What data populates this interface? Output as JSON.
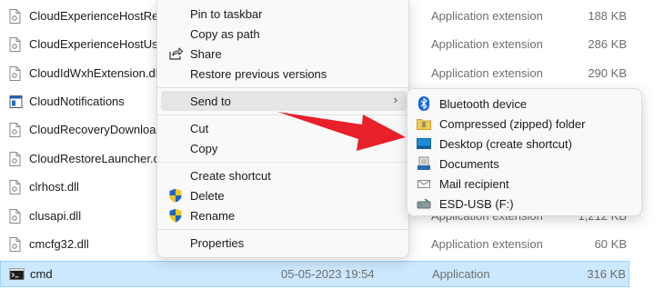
{
  "files": [
    {
      "name": "CloudExperienceHostRedir",
      "date": "",
      "type": "Application extension",
      "size": "188 KB",
      "icon": "dll-file-icon"
    },
    {
      "name": "CloudExperienceHostUser.",
      "date": "",
      "type": "Application extension",
      "size": "286 KB",
      "icon": "dll-file-icon"
    },
    {
      "name": "CloudIdWxhExtension.dll",
      "date": "",
      "type": "Application extension",
      "size": "290 KB",
      "icon": "dll-file-icon"
    },
    {
      "name": "CloudNotifications",
      "date": "",
      "type": "",
      "size": "",
      "icon": "app-window-icon"
    },
    {
      "name": "CloudRecoveryDownloadT",
      "date": "",
      "type": "",
      "size": "",
      "icon": "dll-file-icon"
    },
    {
      "name": "CloudRestoreLauncher.dll",
      "date": "",
      "type": "",
      "size": "",
      "icon": "dll-file-icon"
    },
    {
      "name": "clrhost.dll",
      "date": "",
      "type": "",
      "size": "",
      "icon": "dll-file-icon"
    },
    {
      "name": "clusapi.dll",
      "date": "",
      "type": "Application extension",
      "size": "1,212 KB",
      "icon": "dll-file-icon"
    },
    {
      "name": "cmcfg32.dll",
      "date": "",
      "type": "Application extension",
      "size": "60 KB",
      "icon": "dll-file-icon"
    },
    {
      "name": "cmd",
      "date": "05-05-2023 19:54",
      "type": "Application",
      "size": "316 KB",
      "icon": "cmd-terminal-icon"
    }
  ],
  "context_menu": {
    "pin_taskbar": "Pin to taskbar",
    "copy_path": "Copy as path",
    "share": "Share",
    "restore_versions": "Restore previous versions",
    "send_to": "Send to",
    "send_to_chevron": "›",
    "cut": "Cut",
    "copy": "Copy",
    "create_shortcut": "Create shortcut",
    "delete": "Delete",
    "rename": "Rename",
    "properties": "Properties"
  },
  "send_to_menu": {
    "items": [
      {
        "label": "Bluetooth device",
        "icon": "bluetooth-icon"
      },
      {
        "label": "Compressed (zipped) folder",
        "icon": "zip-folder-icon"
      },
      {
        "label": "Desktop (create shortcut)",
        "icon": "desktop-icon"
      },
      {
        "label": "Documents",
        "icon": "documents-icon"
      },
      {
        "label": "Mail recipient",
        "icon": "mail-icon"
      },
      {
        "label": "ESD-USB (F:)",
        "icon": "usb-drive-icon"
      }
    ]
  },
  "colors": {
    "selected_row": "#cce8ff",
    "annotation_arrow": "#e8202a",
    "menu_bg": "#f9f9f9"
  }
}
